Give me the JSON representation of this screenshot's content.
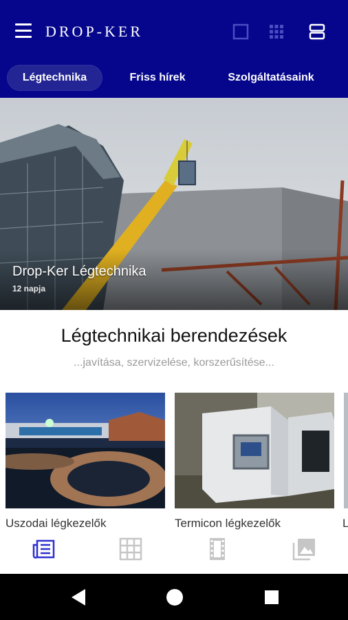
{
  "app": {
    "title": "DROP-KER",
    "brand_color": "#05068c",
    "accent_color": "#2d2fd0"
  },
  "toolbar": {
    "menu_icon": "hamburger-menu-icon",
    "view_icons": [
      "single-square-view-icon",
      "grid-view-icon",
      "list-view-icon"
    ],
    "active_view": "list-view-icon"
  },
  "tabs": [
    {
      "label": "Légtechnika",
      "active": true
    },
    {
      "label": "Friss hírek",
      "active": false
    },
    {
      "label": "Szolgáltatásaink",
      "active": false
    }
  ],
  "hero": {
    "title": "Drop-Ker Légtechnika",
    "date": "12 napja"
  },
  "section": {
    "title": "Légtechnikai berendezések",
    "subtitle": "...javítása, szervizelése, korszerűsítése..."
  },
  "cards": [
    {
      "label": "Uszodai légkezelők"
    },
    {
      "label": "Termicon légkezelők"
    },
    {
      "label": "L"
    }
  ],
  "bottom_nav": [
    {
      "icon": "news-icon",
      "active": true
    },
    {
      "icon": "grid-icon",
      "active": false
    },
    {
      "icon": "film-icon",
      "active": false
    },
    {
      "icon": "gallery-icon",
      "active": false
    }
  ],
  "system_nav": [
    "back-icon",
    "home-icon",
    "recents-icon"
  ]
}
